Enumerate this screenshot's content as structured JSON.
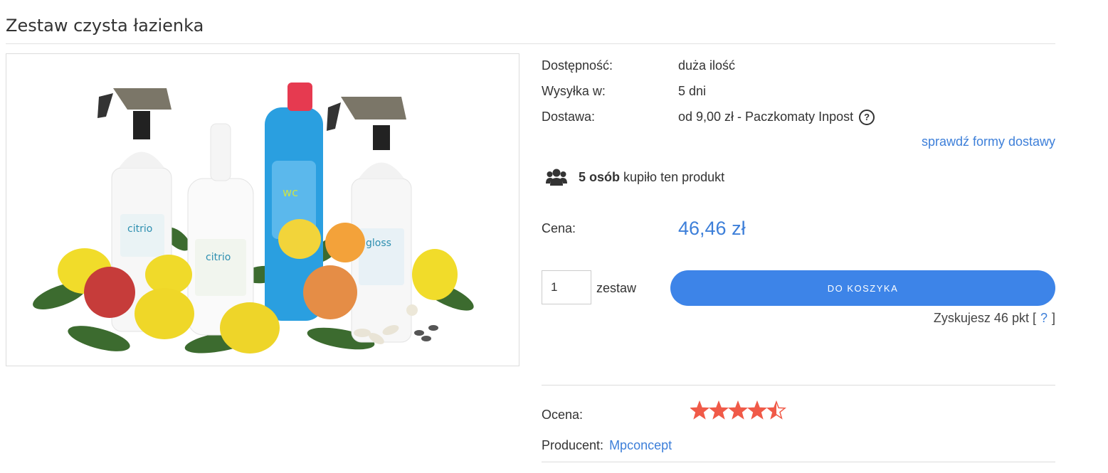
{
  "product": {
    "title": "Zestaw czysta łazienka"
  },
  "details": {
    "availability_label": "Dostępność:",
    "availability_value": "duża ilość",
    "shipping_label": "Wysyłka w:",
    "shipping_value": "5 dni",
    "delivery_label": "Dostawa:",
    "delivery_value": "od 9,00 zł - Paczkomaty Inpost",
    "delivery_help": "?",
    "check_delivery_link": "sprawdź formy dostawy"
  },
  "social": {
    "count": "5 osób",
    "text": "kupiło ten produkt",
    "icon": "users-icon"
  },
  "price": {
    "label": "Cena:",
    "value": "46,46 zł"
  },
  "cart": {
    "quantity": "1",
    "unit": "zestaw",
    "button_label": "DO KOSZYKA"
  },
  "points": {
    "text": "Zyskujesz 46 pkt [",
    "help": "?",
    "close": "]"
  },
  "rating": {
    "label": "Ocena:",
    "stars": 4.5,
    "max": 5,
    "color": "#f05a48"
  },
  "producer": {
    "label": "Producent:",
    "name": "Mpconcept"
  },
  "colors": {
    "accent": "#3d84e8",
    "link": "#3d7fd9"
  }
}
